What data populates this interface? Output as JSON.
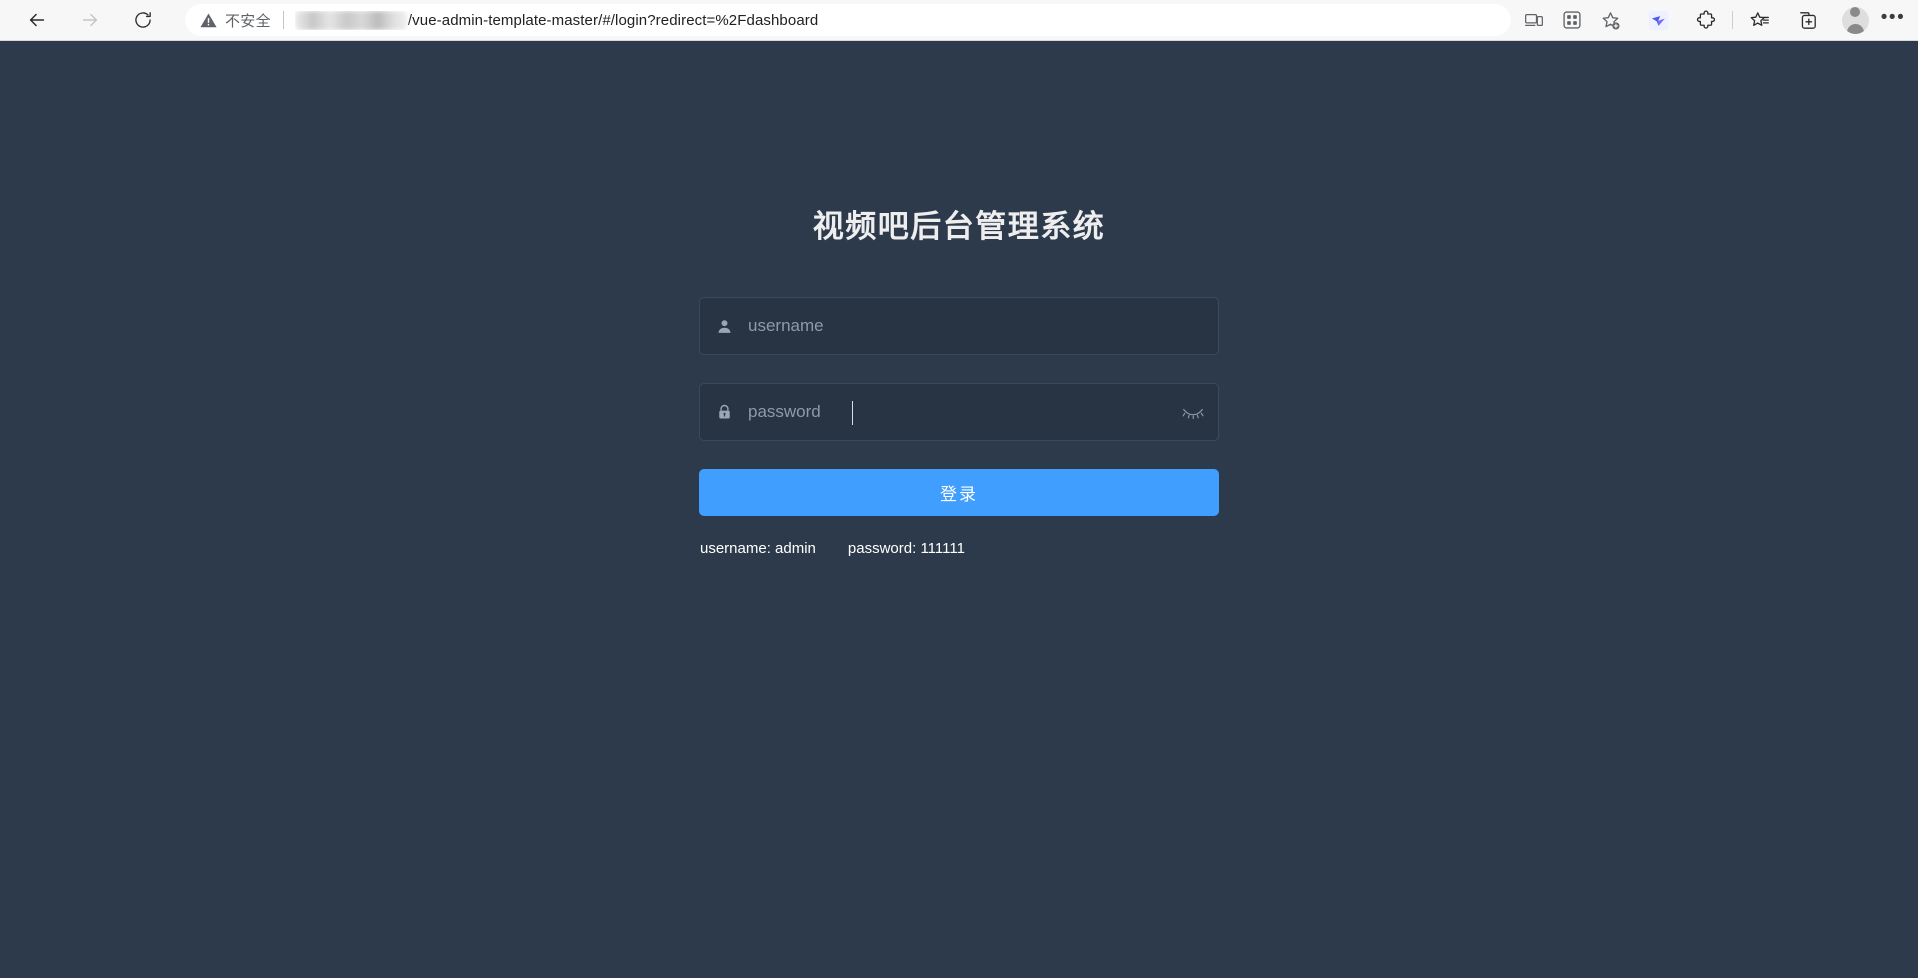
{
  "browser": {
    "nav": {
      "back_label": "Back",
      "forward_label": "Forward",
      "reload_label": "Refresh"
    },
    "address_bar": {
      "security_icon": "warning-triangle-icon",
      "security_label": "不安全",
      "host_redacted": true,
      "url_path": "/vue-admin-template-master/#/login?redirect=%2Fdashboard",
      "full_url_visible": "/vue-admin-template-master/#/login?redirect=%2Fdashboard"
    },
    "toolbar": [
      {
        "name": "cast-device-icon",
        "label": "Cast to device"
      },
      {
        "name": "split-screen-icon",
        "label": "Split screen"
      },
      {
        "name": "add-favorite-icon",
        "label": "Add this page to favorites"
      },
      {
        "name": "extension-bird-icon",
        "label": "Extension"
      },
      {
        "name": "extensions-puzzle-icon",
        "label": "Extensions"
      },
      {
        "name": "favorites-list-icon",
        "label": "Favorites"
      },
      {
        "name": "collections-add-icon",
        "label": "Collections"
      },
      {
        "name": "profile-avatar-icon",
        "label": "Profile"
      },
      {
        "name": "browser-settings-icon",
        "label": "Settings and more"
      }
    ]
  },
  "login": {
    "title": "视频吧后台管理系统",
    "username": {
      "icon": "user-icon",
      "value": "",
      "placeholder": "username"
    },
    "password": {
      "icon": "lock-icon",
      "value": "",
      "placeholder": "password",
      "toggle_icon": "eye-closed-icon",
      "focused": true
    },
    "submit_label": "登录",
    "tips": {
      "username_hint": "username: admin",
      "password_hint": "password: 111111"
    },
    "colors": {
      "page_background": "#2d3a4b",
      "field_background": "#283443",
      "accent_button": "#409eff",
      "title_text": "#eeeeee",
      "placeholder_text": "#889aa4"
    }
  }
}
